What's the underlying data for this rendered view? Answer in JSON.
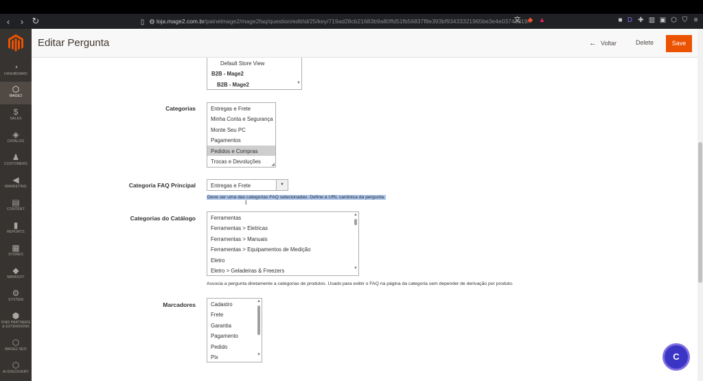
{
  "browser": {
    "url_host": "loja.mage2.com.br",
    "url_path": "/painelmage2/mage2faq/question/edit/id/25/key/719ad28cb21683b9a80ffd51fb56837f8e393bf93433321965be3e4e03743319/",
    "back_icon": "arrow-left-icon",
    "forward_icon": "arrow-right-icon",
    "reload_icon": "reload-icon"
  },
  "sidebar": {
    "items": [
      {
        "label": "DASHBOARD",
        "icon": "speedometer-icon"
      },
      {
        "label": "MAGE2",
        "icon": "hexagon-icon"
      },
      {
        "label": "SALES",
        "icon": "dollar-icon"
      },
      {
        "label": "CATALOG",
        "icon": "box-icon"
      },
      {
        "label": "CUSTOMERS",
        "icon": "person-icon"
      },
      {
        "label": "MARKETING",
        "icon": "megaphone-icon"
      },
      {
        "label": "CONTENT",
        "icon": "content-icon"
      },
      {
        "label": "REPORTS",
        "icon": "bar-chart-icon"
      },
      {
        "label": "STORES",
        "icon": "store-icon"
      },
      {
        "label": "MIRASVIT",
        "icon": "diamond-icon"
      },
      {
        "label": "SYSTEM",
        "icon": "gear-icon"
      },
      {
        "label": "FIND PARTNERS & EXTENSIONS",
        "icon": "puzzle-icon"
      },
      {
        "label": "MAGE2 SEO",
        "icon": "hexagon-icon"
      },
      {
        "label": "AI DISCOVERY",
        "icon": "hexagon-icon"
      }
    ],
    "brand_color": "#eb5202"
  },
  "header": {
    "title": "Editar Pergunta",
    "back_label": "Voltar",
    "delete_label": "Delete",
    "save_label": "Save"
  },
  "store_view": {
    "options": [
      "Default Store View",
      "B2B - Mage2",
      "B2B - Mage2"
    ]
  },
  "categorias": {
    "label": "Categorias",
    "options": [
      "Entregas e Frete",
      "Minha Conta e Segurança",
      "Monte Seu PC",
      "Pagamentos",
      "Pedidos e Compras",
      "Trocas e Devoluções"
    ],
    "selected": "Pedidos e Compras"
  },
  "categoria_principal": {
    "label": "Categoria FAQ Principal",
    "value": "Entregas e Frete",
    "note": "Deve ser uma das categorias FAQ selecionadas. Define a URL canônica da pergunta."
  },
  "categorias_catalogo": {
    "label": "Categorias do Catálogo",
    "options": [
      "Ferramentas",
      "Ferramentas > Eletricas",
      "Ferramentas > Manuais",
      "Ferramentas > Equipamentos de Medição",
      "Eletro",
      "Eletro > Geladeiras & Freezers"
    ],
    "note": "Associa a pergunta diretamente a categorias de produtos. Usado para exibir o FAQ na página da categoria sem depender de derivação por produto."
  },
  "marcadores": {
    "label": "Marcadores",
    "options": [
      "Cadastro",
      "Frete",
      "Garantia",
      "Pagamento",
      "Pedido",
      "Pix"
    ]
  },
  "chat": {
    "label": "C"
  }
}
